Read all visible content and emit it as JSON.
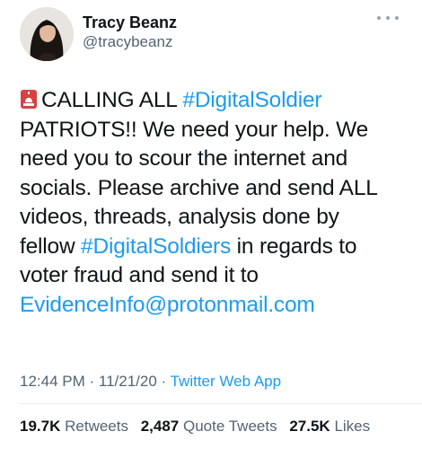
{
  "user": {
    "display_name": "Tracy Beanz",
    "handle": "@tracybeanz"
  },
  "icons": {
    "more": "more-horizontal-icon",
    "emoji": "police-car-light-icon"
  },
  "colors": {
    "link": "#1d9bf0",
    "text": "#0f1419",
    "muted": "#536471"
  },
  "tweet": {
    "l1_text": "CALLING ALL ",
    "l1_hashtag": "#DigitalSoldier",
    "l2": "PATRIOTS!! We need your help. We",
    "l3": "need you to scour the internet and",
    "l4": "socials. Please archive and send ALL",
    "l5": "videos, threads, analysis done by",
    "l6_pre": "fellow ",
    "l6_hashtag": "#DigitalSoldiers",
    "l6_post": " in regards to",
    "l7": "voter fraud and send it to",
    "l8_email": "EvidenceInfo@protonmail.com"
  },
  "meta": {
    "time": "12:44 PM",
    "sep1": " · ",
    "date": "11/21/20",
    "sep2": " · ",
    "app": "Twitter Web App"
  },
  "stats": {
    "retweets_count": "19.7K",
    "retweets_label": "Retweets",
    "quotes_count": "2,487",
    "quotes_label": "Quote Tweets",
    "likes_count": "27.5K",
    "likes_label": "Likes"
  }
}
